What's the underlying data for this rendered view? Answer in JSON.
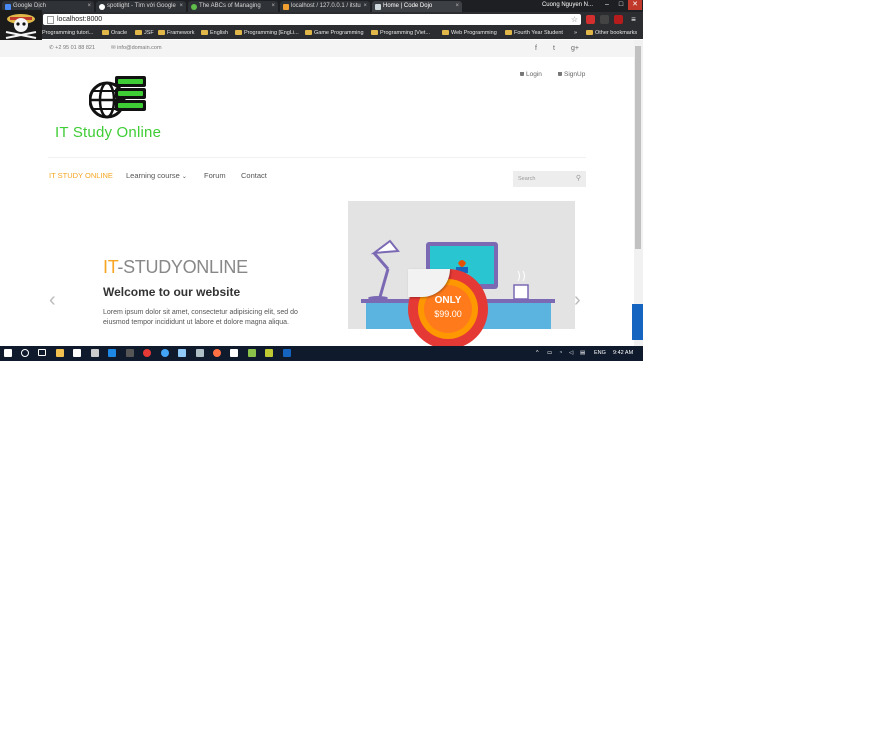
{
  "browser": {
    "tabs": [
      {
        "label": "Google Dịch",
        "color": "#4a8af4"
      },
      {
        "label": "spotlight - Tìm với Google",
        "color": "#ffffff"
      },
      {
        "label": "The ABCs of Managing",
        "color": "#5fbf4a"
      },
      {
        "label": "localhost / 127.0.0.1 / itstu",
        "color": "#f0a030"
      },
      {
        "label": "Home | Code Dojo",
        "color": "#cfd8dc"
      }
    ],
    "user_name": "Cuong Nguyen N...",
    "address": "localhost:8000",
    "bookmarks": [
      "Programming tutori...",
      "Oracle",
      "JSF",
      "Framework",
      "English",
      "Programming [EngLi...",
      "Game Programming",
      "Programming [Viet...",
      "Web Programming",
      "Fourth Year Student",
      "»",
      "Other bookmarks"
    ],
    "window_controls": [
      "–",
      "□",
      "✕"
    ]
  },
  "site": {
    "phone": "+2 95 01 88 821",
    "email": "info@domain.com",
    "social": [
      "f",
      "t",
      "g+"
    ],
    "login": "Login",
    "signup": "SignUp",
    "logo_text": "IT Study Online",
    "nav": [
      "IT STUDY ONLINE",
      "Learning course",
      "Forum",
      "Contact"
    ],
    "search_placeholder": "Search",
    "slider": {
      "brand_prefix": "IT",
      "brand_rest": "-STUDYONLINE",
      "heading": "Welcome to our website",
      "body": "Lorem ipsum dolor sit amet, consectetur adipisicing elit, sed do eiusmod tempor incididunt ut labore et dolore magna aliqua.",
      "badge_top": "ONLY",
      "badge_price": "$99.00",
      "prev": "‹",
      "next": "›"
    },
    "colors": {
      "accent": "#f6a623",
      "logo_green": "#3fcd36",
      "badge_red": "#e53935"
    }
  },
  "taskbar": {
    "language": "ENG",
    "time": "9:42 AM"
  }
}
